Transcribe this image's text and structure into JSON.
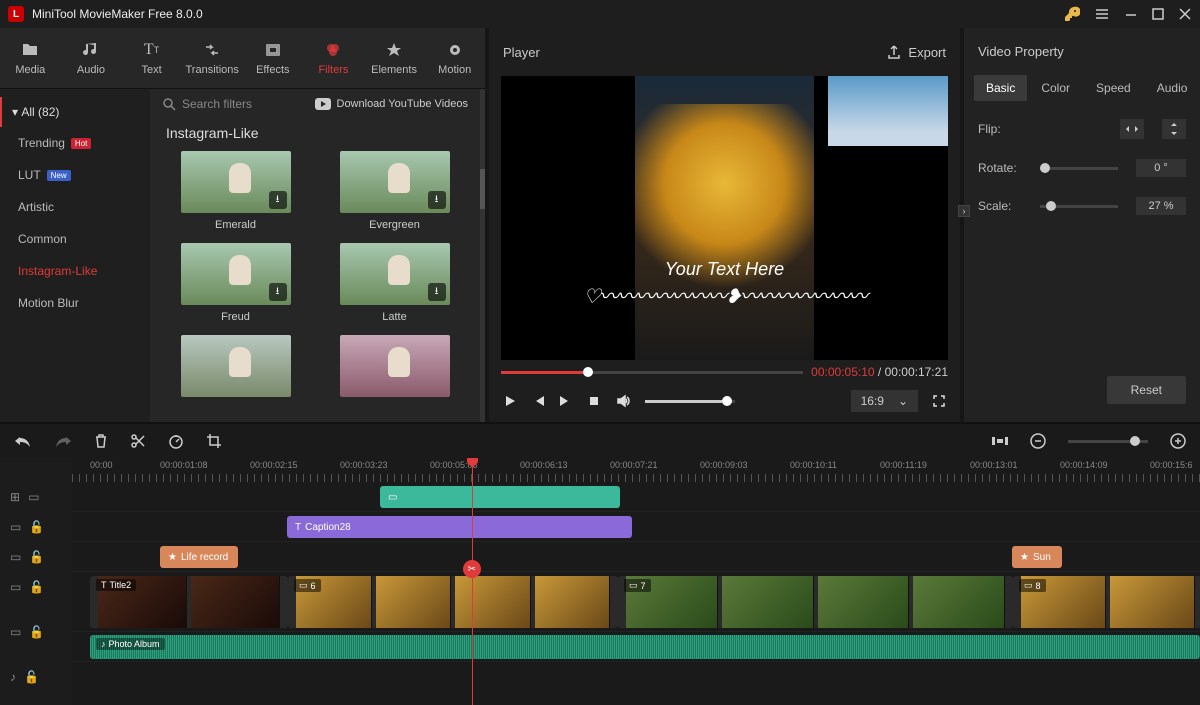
{
  "app": {
    "title": "MiniTool MovieMaker Free 8.0.0"
  },
  "toolbar": [
    {
      "icon": "folder-icon",
      "label": "Media"
    },
    {
      "icon": "music-icon",
      "label": "Audio"
    },
    {
      "icon": "text-icon",
      "label": "Text"
    },
    {
      "icon": "transition-icon",
      "label": "Transitions"
    },
    {
      "icon": "effects-icon",
      "label": "Effects"
    },
    {
      "icon": "filters-icon",
      "label": "Filters",
      "active": true
    },
    {
      "icon": "elements-icon",
      "label": "Elements"
    },
    {
      "icon": "motion-icon",
      "label": "Motion"
    }
  ],
  "filter_sidebar": {
    "all_label": "All (82)",
    "categories": [
      {
        "label": "Trending",
        "badge": "Hot"
      },
      {
        "label": "LUT",
        "badge": "New"
      },
      {
        "label": "Artistic"
      },
      {
        "label": "Common"
      },
      {
        "label": "Instagram-Like",
        "active": true
      },
      {
        "label": "Motion Blur"
      }
    ]
  },
  "filter_content": {
    "search_placeholder": "Search filters",
    "download_label": "Download YouTube Videos",
    "group_title": "Instagram-Like",
    "items": [
      "Emerald",
      "Evergreen",
      "Freud",
      "Latte",
      "",
      ""
    ]
  },
  "player": {
    "header": "Player",
    "export_label": "Export",
    "overlay_text": "Your Text Here",
    "time_current": "00:00:05:10",
    "time_total": "00:00:17:21",
    "aspect": "16:9"
  },
  "props": {
    "header": "Video Property",
    "tabs": [
      "Basic",
      "Color",
      "Speed",
      "Audio"
    ],
    "active_tab": 0,
    "flip_label": "Flip:",
    "rotate_label": "Rotate:",
    "rotate_value": "0 °",
    "scale_label": "Scale:",
    "scale_value": "27 %",
    "reset_label": "Reset"
  },
  "timeline": {
    "ruler": [
      "00:00",
      "00:00:01:08",
      "00:00:02:15",
      "00:00:03:23",
      "00:00:05:06",
      "00:00:06:13",
      "00:00:07:21",
      "00:00:09:03",
      "00:00:10:11",
      "00:00:11:19",
      "00:00:13:01",
      "00:00:14:09",
      "00:00:15:6"
    ],
    "caption_label": "Caption28",
    "life_record_label": "Life record",
    "sun_label": "Sun",
    "title_label": "Title2",
    "v6_label": "6",
    "v7_label": "7",
    "v8_label": "8",
    "audio_label": "Photo Album"
  }
}
